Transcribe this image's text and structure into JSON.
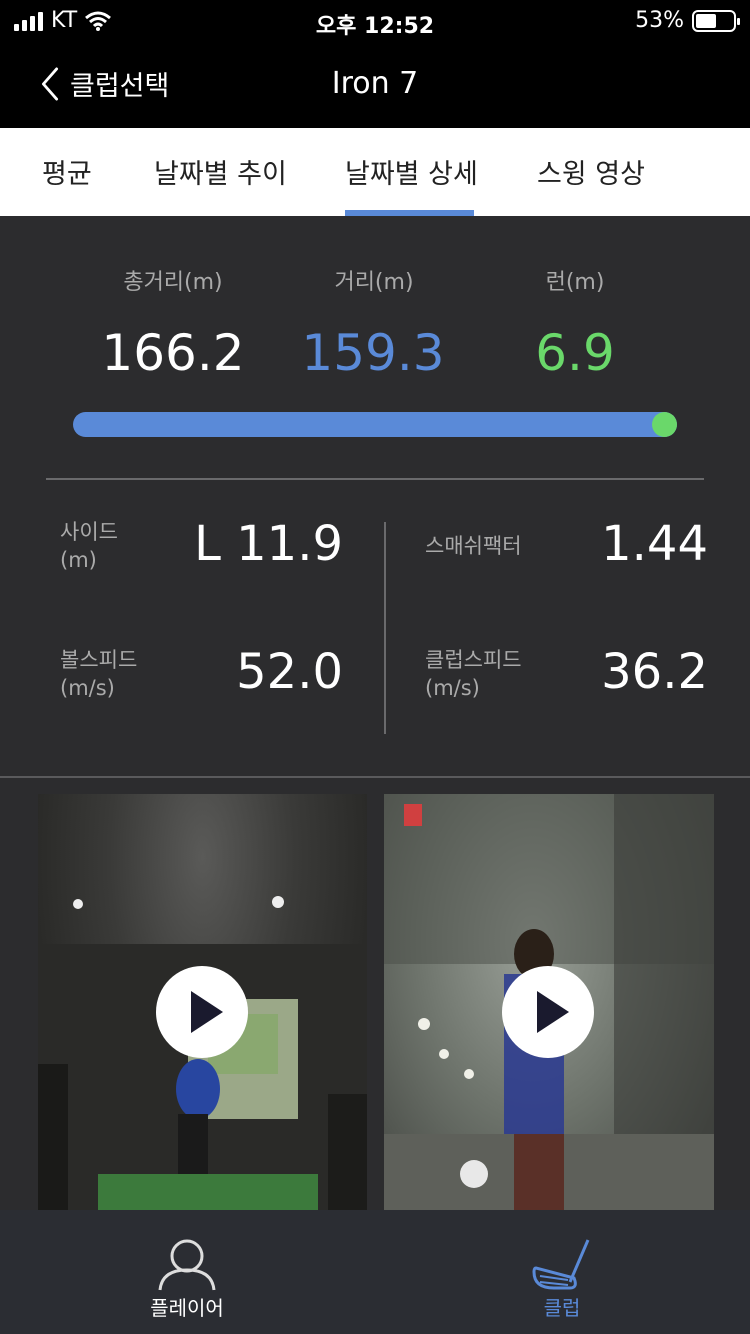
{
  "status_bar": {
    "carrier": "KT",
    "time": "오후 12:52",
    "battery": "53%",
    "battery_level": 0.53
  },
  "nav": {
    "back_label": "클럽선택",
    "title": "Iron 7"
  },
  "tabs": [
    {
      "label": "평균"
    },
    {
      "label": "날짜별 추이"
    },
    {
      "label": "날짜별 상세",
      "active": true
    },
    {
      "label": "스윙 영상"
    }
  ],
  "distance": {
    "total_label": "총거리(m)",
    "total_value": "166.2",
    "carry_label": "거리(m)",
    "carry_value": "159.3",
    "run_label": "런(m)",
    "run_value": "6.9",
    "carry_color": "#5a8ad8",
    "run_color": "#6ad86a"
  },
  "stats": {
    "side_label_1": "사이드",
    "side_label_2": "(m)",
    "side_value": "L 11.9",
    "smash_label": "스매쉬팩터",
    "smash_value": "1.44",
    "ball_label_1": "볼스피드",
    "ball_label_2": "(m/s)",
    "ball_value": "52.0",
    "club_label_1": "클럽스피드",
    "club_label_2": "(m/s)",
    "club_value": "36.2"
  },
  "videos": [
    {
      "icon": "play-icon"
    },
    {
      "icon": "play-icon"
    }
  ],
  "tabbar": {
    "player_label": "플레이어",
    "player_icon": "person-icon",
    "club_label": "클럽",
    "club_icon": "golf-club-icon",
    "active_color": "#5a8ad8"
  }
}
